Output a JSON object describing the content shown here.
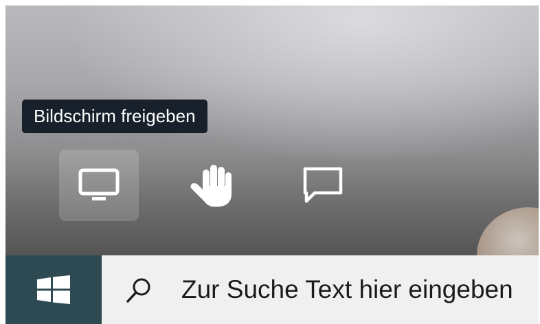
{
  "meeting_toolbar": {
    "tooltip": "Bildschirm freigeben",
    "buttons": [
      {
        "icon": "monitor-icon",
        "active": true
      },
      {
        "icon": "raise-hand-icon",
        "active": false
      },
      {
        "icon": "chat-bubble-icon",
        "active": false
      }
    ]
  },
  "taskbar": {
    "start_icon": "windows-logo-icon",
    "search": {
      "icon": "search-icon",
      "placeholder": "Zur Suche Text hier eingeben"
    }
  },
  "colors": {
    "tooltip_bg": "#17202b",
    "start_button_bg": "#2e4a53",
    "search_bg": "#f0f0f0",
    "icon_color": "#ffffff"
  }
}
